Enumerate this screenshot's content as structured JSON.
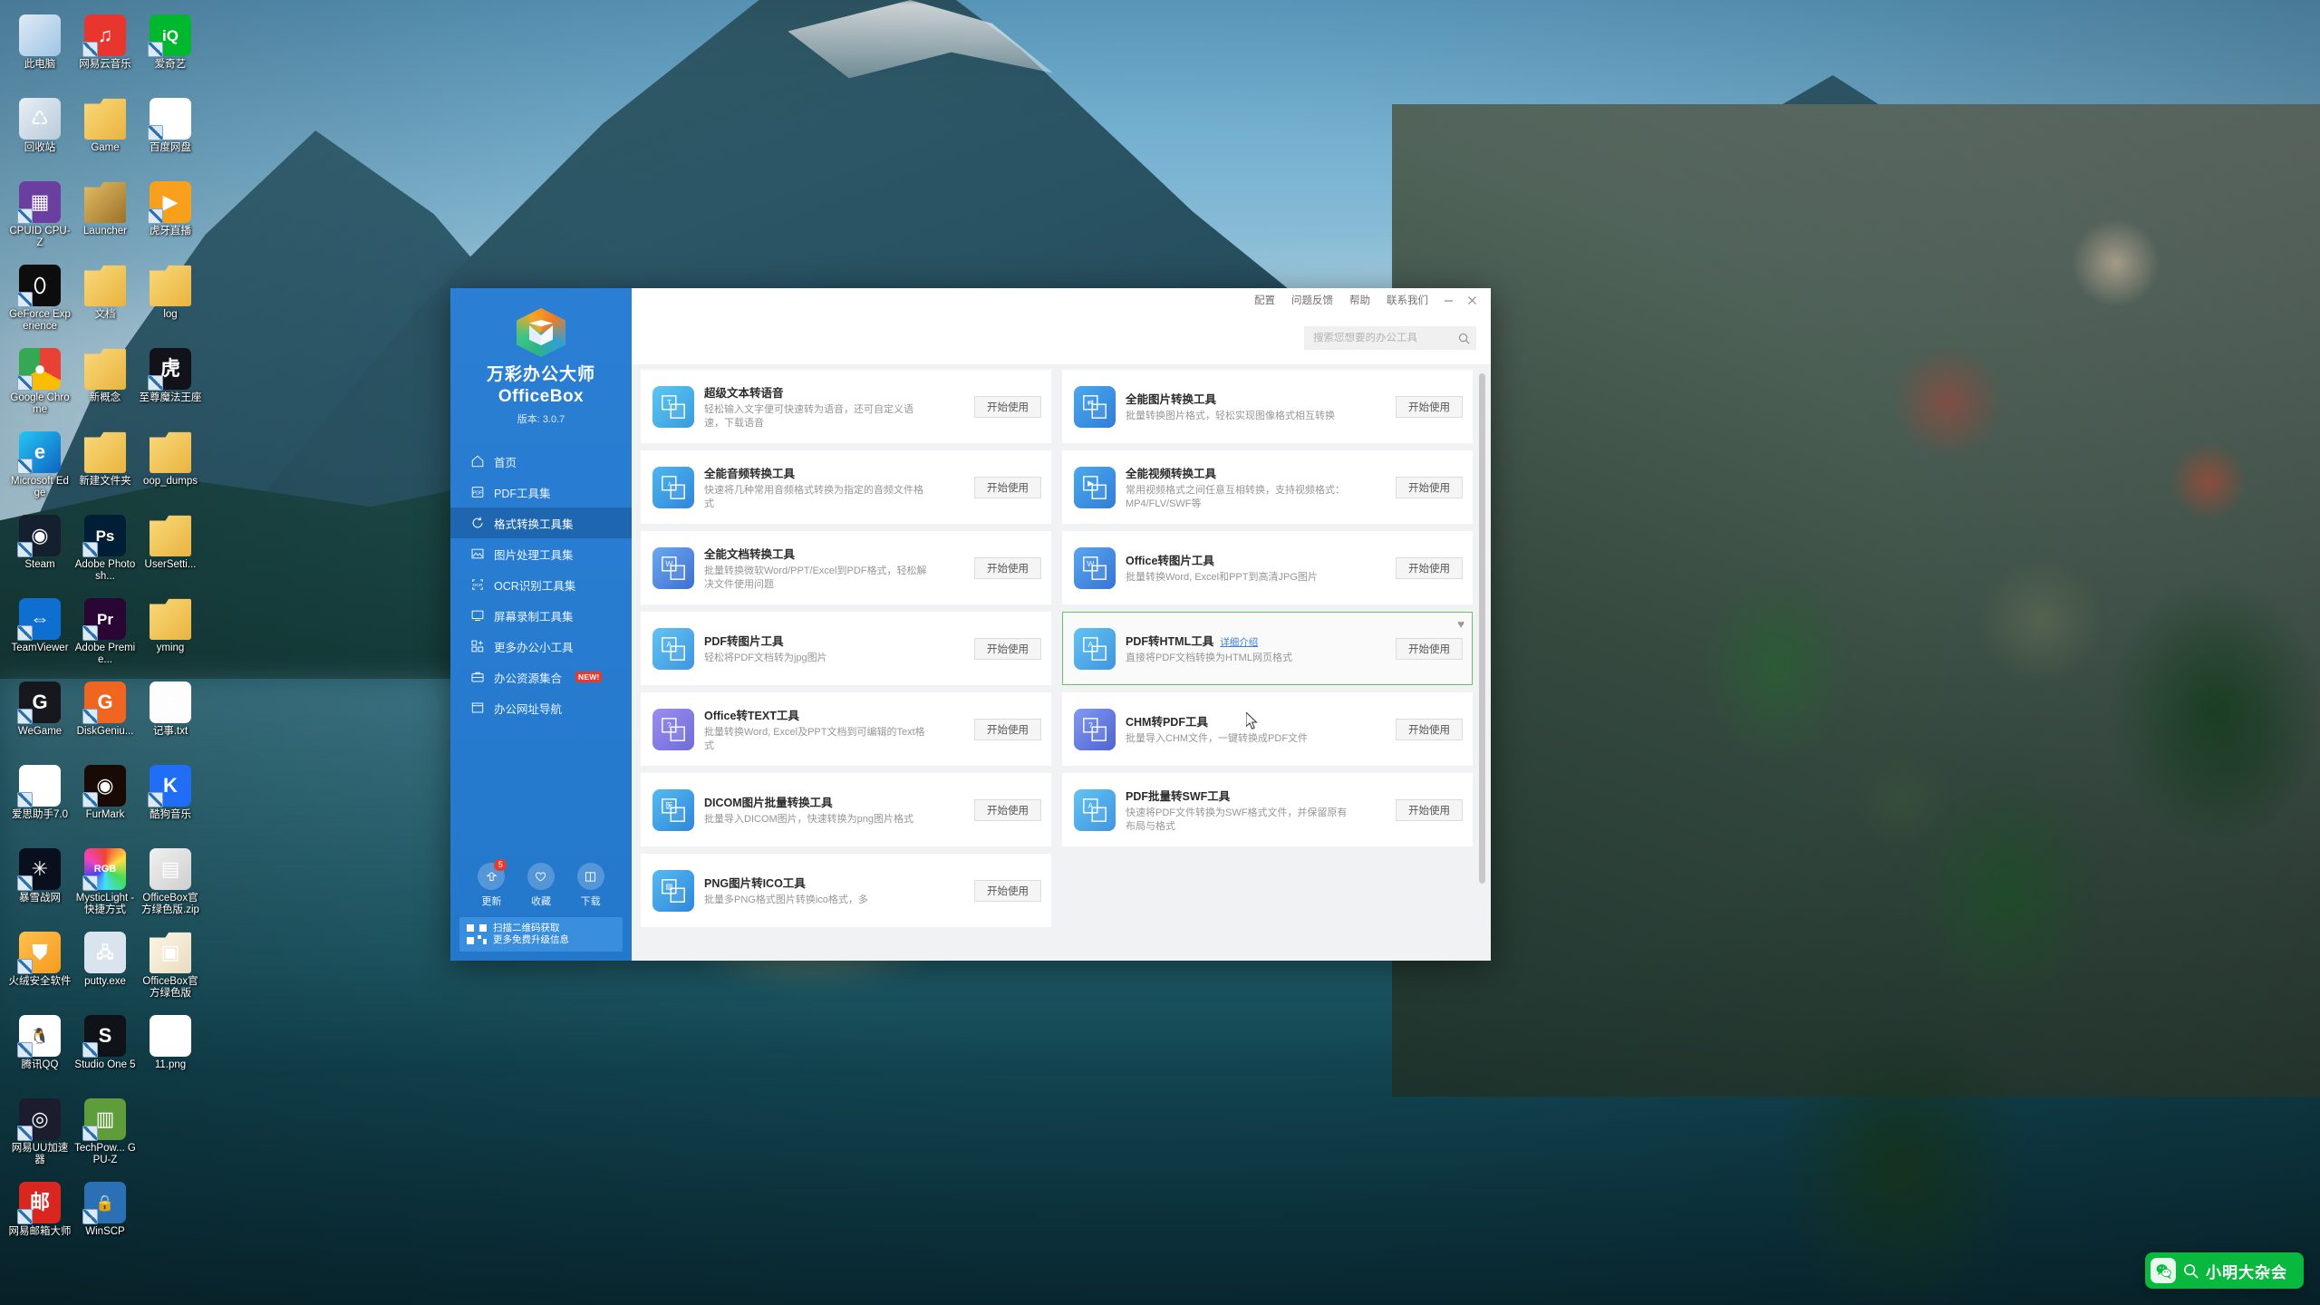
{
  "desktop": {
    "icons": [
      {
        "label": "此电脑",
        "kind": "computer",
        "arrow": false,
        "bg": "linear-gradient(135deg,#dfeaf5,#9fc4e4)",
        "glyph": ""
      },
      {
        "label": "网易云音乐",
        "kind": "netease-music",
        "arrow": true,
        "bg": "#e8352e",
        "glyph": "♫"
      },
      {
        "label": "爱奇艺",
        "kind": "iqiyi",
        "arrow": true,
        "bg": "#00b82d",
        "glyph": "iQ"
      },
      {
        "label": "回收站",
        "kind": "recycle-bin",
        "arrow": false,
        "bg": "linear-gradient(135deg,#e8eef4,#b9cbdb)",
        "glyph": "♺"
      },
      {
        "label": "Game",
        "kind": "folder",
        "arrow": false,
        "bg": "linear-gradient(135deg,#fbd97a,#e8b43f)",
        "glyph": ""
      },
      {
        "label": "百度网盘",
        "kind": "baidu-netdisk",
        "arrow": true,
        "bg": "#ffffff",
        "glyph": "☁"
      },
      {
        "label": "CPUID CPU-Z",
        "kind": "cpu-z",
        "arrow": true,
        "bg": "#6a3fa0",
        "glyph": "▦"
      },
      {
        "label": "Launcher",
        "kind": "folder",
        "arrow": false,
        "bg": "linear-gradient(135deg,#e3bd66,#9c7227)",
        "glyph": ""
      },
      {
        "label": "虎牙直播",
        "kind": "huya",
        "arrow": true,
        "bg": "#f8a01c",
        "glyph": "▶"
      },
      {
        "label": "GeForce Experience",
        "kind": "geforce",
        "arrow": true,
        "bg": "#0d0d0d",
        "glyph": "⬯"
      },
      {
        "label": "文档",
        "kind": "folder",
        "arrow": false,
        "bg": "linear-gradient(135deg,#fbd97a,#e8b43f)",
        "glyph": ""
      },
      {
        "label": "log",
        "kind": "folder",
        "arrow": false,
        "bg": "linear-gradient(135deg,#fbd97a,#e8b43f)",
        "glyph": ""
      },
      {
        "label": "Google Chrome",
        "kind": "chrome",
        "arrow": true,
        "bg": "conic-gradient(#e94235 0 33%,#fbbc04 0 66%,#34a853 0 100%)",
        "glyph": "●"
      },
      {
        "label": "新概念",
        "kind": "folder",
        "arrow": false,
        "bg": "linear-gradient(135deg,#fbd97a,#e8b43f)",
        "glyph": ""
      },
      {
        "label": "至尊魔法王座",
        "kind": "game-app",
        "arrow": true,
        "bg": "#12131a",
        "glyph": "虎"
      },
      {
        "label": "Microsoft Edge",
        "kind": "edge",
        "arrow": true,
        "bg": "linear-gradient(135deg,#25c6f4,#0e63c3)",
        "glyph": "e"
      },
      {
        "label": "新建文件夹",
        "kind": "folder",
        "arrow": false,
        "bg": "linear-gradient(135deg,#fbd97a,#e8b43f)",
        "glyph": ""
      },
      {
        "label": "oop_dumps",
        "kind": "folder",
        "arrow": false,
        "bg": "linear-gradient(135deg,#fbd97a,#e8b43f)",
        "glyph": ""
      },
      {
        "label": "Steam",
        "kind": "steam",
        "arrow": true,
        "bg": "#14202e",
        "glyph": "◉"
      },
      {
        "label": "Adobe Photosh...",
        "kind": "photoshop",
        "arrow": true,
        "bg": "#001e36",
        "glyph": "Ps"
      },
      {
        "label": "UserSetti...",
        "kind": "folder",
        "arrow": false,
        "bg": "linear-gradient(135deg,#fbd97a,#e8b43f)",
        "glyph": ""
      },
      {
        "label": "TeamViewer",
        "kind": "teamviewer",
        "arrow": true,
        "bg": "#0e6fd0",
        "glyph": "⇔"
      },
      {
        "label": "Adobe Premie...",
        "kind": "premiere",
        "arrow": true,
        "bg": "#2a0634",
        "glyph": "Pr"
      },
      {
        "label": "yming",
        "kind": "folder",
        "arrow": false,
        "bg": "linear-gradient(135deg,#fbd97a,#e8b43f)",
        "glyph": ""
      },
      {
        "label": "WeGame",
        "kind": "wegame",
        "arrow": true,
        "bg": "#17181d",
        "glyph": "G"
      },
      {
        "label": "DiskGeniu...",
        "kind": "diskgenius",
        "arrow": true,
        "bg": "#f0651f",
        "glyph": "G"
      },
      {
        "label": "记事.txt",
        "kind": "text-file",
        "arrow": false,
        "bg": "#fdfdfd",
        "glyph": "≡"
      },
      {
        "label": "爱思助手7.0",
        "kind": "aisi",
        "arrow": true,
        "bg": "#ffffff",
        "glyph": "iU"
      },
      {
        "label": "FurMark",
        "kind": "furmark",
        "arrow": true,
        "bg": "#1a0a06",
        "glyph": "◉"
      },
      {
        "label": "酷狗音乐",
        "kind": "kugou",
        "arrow": true,
        "bg": "#1f6ef5",
        "glyph": "K"
      },
      {
        "label": "暴雪战网",
        "kind": "battlenet",
        "arrow": true,
        "bg": "#0a0f1e",
        "glyph": "✳"
      },
      {
        "label": "MysticLight - 快捷方式",
        "kind": "mystic-light",
        "arrow": true,
        "bg": "conic-gradient(#e43,#fd4,#4d5,#4df,#44e,#e4b,#e43)",
        "glyph": "RGB"
      },
      {
        "label": "OfficeBox官方绿色版.zip",
        "kind": "zip-archive",
        "arrow": false,
        "bg": "linear-gradient(135deg,#f0f0f0,#cfcfcf)",
        "glyph": "▤"
      },
      {
        "label": "火绒安全软件",
        "kind": "huorong",
        "arrow": true,
        "bg": "linear-gradient(135deg,#ffc14d,#f59a1f)",
        "glyph": "⛊"
      },
      {
        "label": "putty.exe",
        "kind": "putty",
        "arrow": false,
        "bg": "#d9e4ef",
        "glyph": "🖧"
      },
      {
        "label": "OfficeBox官方绿色版",
        "kind": "officebox-folder",
        "arrow": false,
        "bg": "linear-gradient(135deg,#fdf6e4,#e8dcc0)",
        "glyph": "▣"
      },
      {
        "label": "腾讯QQ",
        "kind": "tencent-qq",
        "arrow": true,
        "bg": "#ffffff",
        "glyph": "🐧"
      },
      {
        "label": "Studio One 5",
        "kind": "studio-one",
        "arrow": true,
        "bg": "#0f1318",
        "glyph": "S"
      },
      {
        "label": "11.png",
        "kind": "image-file",
        "arrow": false,
        "bg": "#ffffff",
        "glyph": "▨"
      },
      {
        "label": "网易UU加速器",
        "kind": "netease-uu",
        "arrow": true,
        "bg": "#1b1c2e",
        "glyph": "◎"
      },
      {
        "label": "TechPow... GPU-Z",
        "kind": "gpu-z",
        "arrow": true,
        "bg": "#5f9d3a",
        "glyph": "▥"
      },
      {
        "label": "",
        "kind": "empty",
        "arrow": false,
        "bg": "transparent",
        "glyph": ""
      },
      {
        "label": "网易邮箱大师",
        "kind": "netease-mail",
        "arrow": true,
        "bg": "#d9271f",
        "glyph": "邮"
      },
      {
        "label": "WinSCP",
        "kind": "winscp",
        "arrow": true,
        "bg": "#2b6fb5",
        "glyph": "🔒"
      }
    ]
  },
  "app": {
    "brand": {
      "name_cn": "万彩办公大师",
      "name_en": "OfficeBox",
      "version": "版本: 3.0.7"
    },
    "titlebar": {
      "links": [
        "配置",
        "问题反馈",
        "帮助",
        "联系我们"
      ],
      "minimize": "minimize-icon",
      "close": "close-icon"
    },
    "search": {
      "placeholder": "搜索您想要的办公工具",
      "value": "",
      "icon": "search-icon"
    },
    "nav": [
      {
        "label": "首页",
        "icon": "home-icon",
        "active": false,
        "badge": ""
      },
      {
        "label": "PDF工具集",
        "icon": "pdf-icon",
        "active": false,
        "badge": ""
      },
      {
        "label": "格式转换工具集",
        "icon": "convert-icon",
        "active": true,
        "badge": ""
      },
      {
        "label": "图片处理工具集",
        "icon": "image-icon",
        "active": false,
        "badge": ""
      },
      {
        "label": "OCR识别工具集",
        "icon": "ocr-icon",
        "active": false,
        "badge": ""
      },
      {
        "label": "屏幕录制工具集",
        "icon": "screen-record-icon",
        "active": false,
        "badge": ""
      },
      {
        "label": "更多办公小工具",
        "icon": "more-tools-icon",
        "active": false,
        "badge": ""
      },
      {
        "label": "办公资源集合",
        "icon": "resources-icon",
        "active": false,
        "badge": "NEW!"
      },
      {
        "label": "办公网址导航",
        "icon": "bookmark-icon",
        "active": false,
        "badge": ""
      }
    ],
    "quick_actions": [
      {
        "label": "更新",
        "icon": "update-icon",
        "count": "5"
      },
      {
        "label": "收藏",
        "icon": "heart-icon",
        "count": ""
      },
      {
        "label": "下载",
        "icon": "download-book-icon",
        "count": ""
      }
    ],
    "qr_strip": {
      "icon": "qrcode-icon",
      "line1": "扫描二维码获取",
      "line2": "更多免费升级信息"
    },
    "cards": [
      {
        "title": "超级文本转语音",
        "desc": "轻松输入文字便可快速转为语音，还可自定义语速，下载语音",
        "button": "开始使用",
        "icon_bg": "linear-gradient(135deg,#5bc8f0,#3a9ae0)",
        "glyph": "T",
        "link": "",
        "favorited": false,
        "selected": false
      },
      {
        "title": "全能图片转换工具",
        "desc": "批量转换图片格式，轻松实现图像格式相互转换",
        "button": "开始使用",
        "icon_bg": "linear-gradient(135deg,#4aa8ef,#2f7ed8)",
        "glyph": "⇄",
        "link": "",
        "favorited": false,
        "selected": false
      },
      {
        "title": "全能音频转换工具",
        "desc": "快速将几种常用音频格式转换为指定的音频文件格式",
        "button": "开始使用",
        "icon_bg": "linear-gradient(135deg,#4fb5ef,#2f86da)",
        "glyph": "♪",
        "link": "",
        "favorited": false,
        "selected": false
      },
      {
        "title": "全能视频转换工具",
        "desc": "常用视频格式之间任意互相转换，支持视频格式：MP4/FLV/SWF等",
        "button": "开始使用",
        "icon_bg": "linear-gradient(135deg,#4aa8ef,#2f7ed8)",
        "glyph": "▶",
        "link": "",
        "favorited": false,
        "selected": false
      },
      {
        "title": "全能文档转换工具",
        "desc": "批量转换微软Word/PPT/Excel到PDF格式，轻松解决文件使用问题",
        "button": "开始使用",
        "icon_bg": "linear-gradient(135deg,#6aa8f0,#3f6fd0)",
        "glyph": "W",
        "link": "",
        "favorited": false,
        "selected": false
      },
      {
        "title": "Office转图片工具",
        "desc": "批量转换Word, Excel和PPT到高清JPG图片",
        "button": "开始使用",
        "icon_bg": "linear-gradient(135deg,#5aa6f0,#3574d4)",
        "glyph": "W",
        "link": "",
        "favorited": false,
        "selected": false
      },
      {
        "title": "PDF转图片工具",
        "desc": "轻松将PDF文档转为jpg图片",
        "button": "开始使用",
        "icon_bg": "linear-gradient(135deg,#63c3f2,#3f95e0)",
        "glyph": "A",
        "link": "",
        "favorited": false,
        "selected": false
      },
      {
        "title": "PDF转HTML工具",
        "desc": "直接将PDF文档转换为HTML网页格式",
        "button": "开始使用",
        "icon_bg": "linear-gradient(135deg,#63c3f2,#3f95e0)",
        "glyph": "A",
        "link": "详细介绍",
        "favorited": true,
        "selected": true
      },
      {
        "title": "Office转TEXT工具",
        "desc": "批量转换Word, Excel及PPT文档到可编辑的Text格式",
        "button": "开始使用",
        "icon_bg": "linear-gradient(135deg,#9a8ef0,#6f6cd8)",
        "glyph": "?",
        "link": "",
        "favorited": false,
        "selected": false
      },
      {
        "title": "CHM转PDF工具",
        "desc": "批量导入CHM文件，一键转换成PDF文件",
        "button": "开始使用",
        "icon_bg": "linear-gradient(135deg,#7f9bf2,#4f63cf)",
        "glyph": "?",
        "link": "",
        "favorited": false,
        "selected": false
      },
      {
        "title": "DICOM图片批量转换工具",
        "desc": "批量导入DICOM图片，快速转换为png图片格式",
        "button": "开始使用",
        "icon_bg": "linear-gradient(135deg,#55bbf2,#2f86da)",
        "glyph": "医",
        "link": "",
        "favorited": false,
        "selected": false
      },
      {
        "title": "PDF批量转SWF工具",
        "desc": "快速将PDF文件转换为SWF格式文件，并保留原有布局与格式",
        "button": "开始使用",
        "icon_bg": "linear-gradient(135deg,#63c3f2,#3f95e0)",
        "glyph": "A",
        "link": "",
        "favorited": false,
        "selected": false
      },
      {
        "title": "PNG图片转ICO工具",
        "desc": "批量多PNG格式图片转换ico格式，多",
        "button": "开始使用",
        "icon_bg": "linear-gradient(135deg,#55bbf2,#2f86da)",
        "glyph": "▨",
        "link": "",
        "favorited": false,
        "selected": false
      }
    ]
  },
  "widget": {
    "text": "小明大杂会",
    "search_icon": "search-icon",
    "app_icon": "wechat-icon",
    "color": "#09b83e"
  }
}
